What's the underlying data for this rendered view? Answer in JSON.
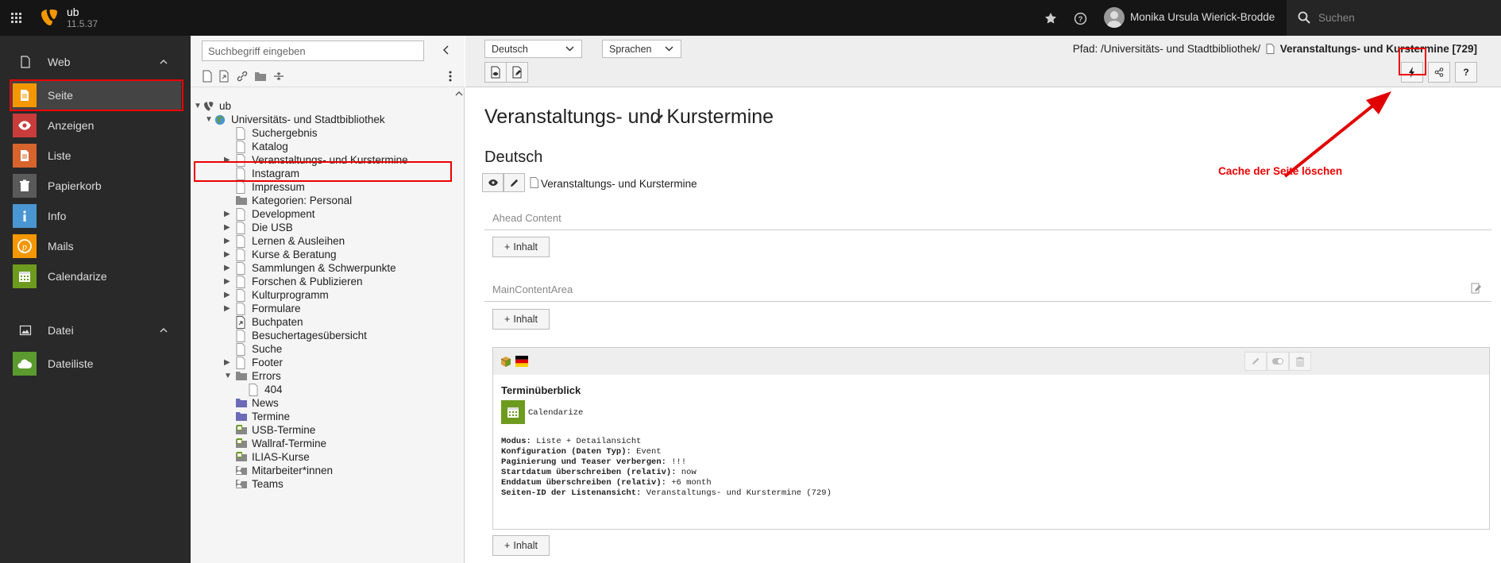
{
  "topbar": {
    "site_name": "ub",
    "site_version": "11.5.37",
    "user_name": "Monika Ursula Wierick-Brodde",
    "search_placeholder": "Suchen",
    "icons": [
      "app-grid-icon",
      "typo3-logo-icon",
      "star-icon",
      "help-icon",
      "user-avatar-icon",
      "search-icon"
    ]
  },
  "modules": {
    "groups": [
      {
        "label": "Web",
        "icon": "page-icon"
      },
      {
        "label": "Datei",
        "icon": "image-icon"
      }
    ],
    "web_items": [
      {
        "label": "Seite",
        "icon": "page-module-icon",
        "color": "#f49700"
      },
      {
        "label": "Anzeigen",
        "icon": "eye-icon",
        "color": "#c83c3c"
      },
      {
        "label": "Liste",
        "icon": "list-icon",
        "color": "#d7642d"
      },
      {
        "label": "Papierkorb",
        "icon": "trash-icon",
        "color": "#5a5a5a"
      },
      {
        "label": "Info",
        "icon": "info-icon",
        "color": "#4a96d2"
      },
      {
        "label": "Mails",
        "icon": "mails-icon",
        "color": "#f49700"
      },
      {
        "label": "Calendarize",
        "icon": "calendar-icon",
        "color": "#6d9b1e"
      }
    ],
    "datei_items": [
      {
        "label": "Dateiliste",
        "icon": "filelist-icon",
        "color": "#5a9a2f"
      }
    ]
  },
  "tree": {
    "search_placeholder": "Suchbegriff eingeben",
    "nodes": [
      {
        "label": "ub"
      },
      {
        "label": "Universitäts- und Stadtbibliothek"
      },
      {
        "label": "Suchergebnis"
      },
      {
        "label": "Katalog"
      },
      {
        "label": "Veranstaltungs- und Kurstermine"
      },
      {
        "label": "Instagram"
      },
      {
        "label": "Impressum"
      },
      {
        "label": "Kategorien: Personal"
      },
      {
        "label": "Development"
      },
      {
        "label": "Die USB"
      },
      {
        "label": "Lernen & Ausleihen"
      },
      {
        "label": "Kurse & Beratung"
      },
      {
        "label": "Sammlungen & Schwerpunkte"
      },
      {
        "label": "Forschen & Publizieren"
      },
      {
        "label": "Kulturprogramm"
      },
      {
        "label": "Formulare"
      },
      {
        "label": "Buchpaten"
      },
      {
        "label": "Besuchertagesübersicht"
      },
      {
        "label": "Suche"
      },
      {
        "label": "Footer"
      },
      {
        "label": "Errors"
      },
      {
        "label": "404"
      },
      {
        "label": "News"
      },
      {
        "label": "Termine"
      },
      {
        "label": "USB-Termine"
      },
      {
        "label": "Wallraf-Termine"
      },
      {
        "label": "ILIAS-Kurse"
      },
      {
        "label": "Mitarbeiter*innen"
      },
      {
        "label": "Teams"
      }
    ]
  },
  "docheader": {
    "language_select": "Deutsch",
    "languages_select": "Sprachen",
    "path_prefix": "Pfad: /Universitäts- und Stadtbibliothek/",
    "path_current": "Veranstaltungs- und Kurstermine [729]"
  },
  "main": {
    "page_title": "Veranstaltungs- und Kurstermine",
    "language_heading": "Deutsch",
    "page_link": "Veranstaltungs- und Kurstermine",
    "columns": [
      {
        "label": "Ahead Content"
      },
      {
        "label": "MainContentArea"
      }
    ],
    "add_content_label": "Inhalt",
    "content_element": {
      "title": "Terminüberblick",
      "plugin": "Calendarize",
      "fields": [
        {
          "key": "Modus:",
          "value": "Liste + Detailansicht"
        },
        {
          "key": "Konfiguration (Daten Typ):",
          "value": "Event"
        },
        {
          "key": "Paginierung und Teaser verbergen:",
          "value": "!!!"
        },
        {
          "key": "Startdatum überschreiben (relativ):",
          "value": "now"
        },
        {
          "key": "Enddatum überschreiben (relativ):",
          "value": "+6 month"
        },
        {
          "key": "Seiten-ID der Listenansicht:",
          "value": "Veranstaltungs- und Kurstermine (729)"
        }
      ]
    }
  },
  "annotation": {
    "text": "Cache der Seite löschen",
    "color": "#e00000"
  }
}
